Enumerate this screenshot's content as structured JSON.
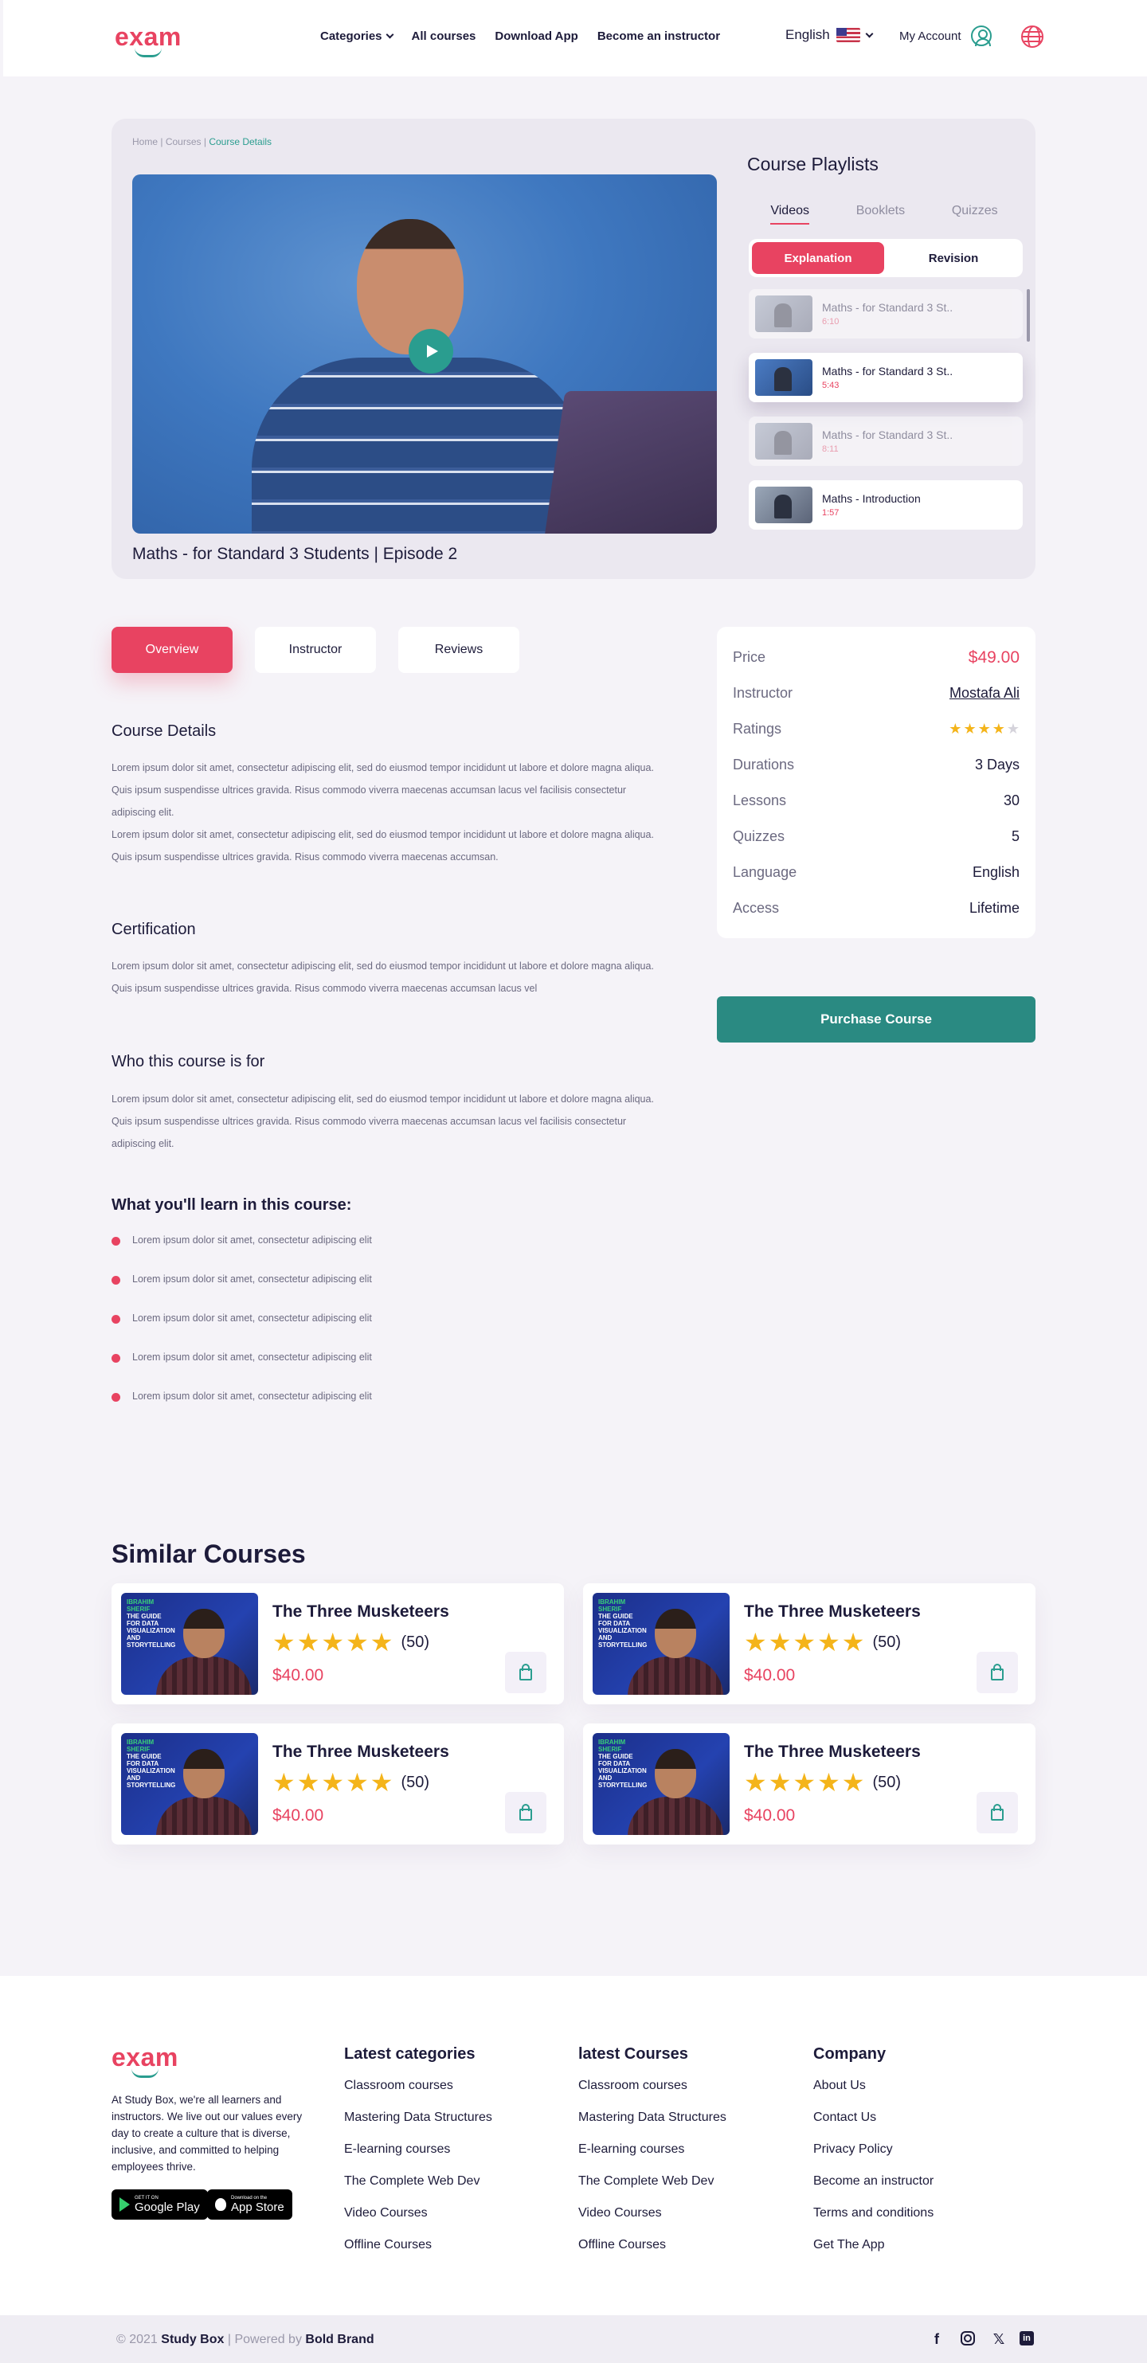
{
  "header": {
    "logo": "exam",
    "nav": [
      "Categories",
      "All courses",
      "Download App",
      "Become an instructor"
    ],
    "language": "English",
    "account": "My Account"
  },
  "breadcrumb": {
    "home": "Home",
    "courses": "Courses",
    "current": "Course Details",
    "separator": "|"
  },
  "video": {
    "title": "Maths - for Standard 3 Students | Episode 2"
  },
  "playlist": {
    "title": "Course Playlists",
    "tabs": [
      "Videos",
      "Booklets",
      "Quizzes"
    ],
    "segments": [
      "Explanation",
      "Revision"
    ],
    "items": [
      {
        "name": "Maths - for Standard 3 St..",
        "duration": "6:10"
      },
      {
        "name": "Maths - for Standard 3 St..",
        "duration": "5:43"
      },
      {
        "name": "Maths - for Standard 3 St..",
        "duration": "8:11"
      },
      {
        "name": "Maths - Introduction",
        "duration": "1:57"
      }
    ]
  },
  "tabs": [
    "Overview",
    "Instructor",
    "Reviews"
  ],
  "content": {
    "details_title": "Course Details",
    "details_p1": "Lorem ipsum dolor sit amet, consectetur adipiscing elit, sed do eiusmod tempor incididunt ut labore et dolore magna aliqua. Quis ipsum suspendisse ultrices gravida. Risus commodo viverra maecenas accumsan lacus vel facilisis consectetur adipiscing elit.",
    "details_p2": "Lorem ipsum dolor sit amet, consectetur adipiscing elit, sed do eiusmod tempor incididunt ut labore et dolore magna aliqua. Quis ipsum suspendisse ultrices gravida. Risus commodo viverra maecenas accumsan.",
    "cert_title": "Certification",
    "cert_p": "Lorem ipsum dolor sit amet, consectetur adipiscing elit, sed do eiusmod tempor incididunt ut labore et dolore magna aliqua. Quis ipsum suspendisse ultrices gravida. Risus commodo viverra maecenas accumsan lacus vel",
    "who_title": "Who this course is for",
    "who_p": "Lorem ipsum dolor sit amet, consectetur adipiscing elit, sed do eiusmod tempor incididunt ut labore et dolore magna aliqua. Quis ipsum suspendisse ultrices gravida. Risus commodo viverra maecenas accumsan lacus vel facilisis consectetur adipiscing elit.",
    "learn_title": "What you'll learn in this course:",
    "learn_items": [
      "Lorem ipsum dolor sit amet, consectetur adipiscing elit",
      "Lorem ipsum dolor sit amet, consectetur adipiscing elit",
      "Lorem ipsum dolor sit amet, consectetur adipiscing elit",
      "Lorem ipsum dolor sit amet, consectetur adipiscing elit",
      "Lorem ipsum dolor sit amet, consectetur adipiscing elit"
    ]
  },
  "info": {
    "price_label": "Price",
    "price": "$49.00",
    "instructor_label": "Instructor",
    "instructor": "Mostafa Ali",
    "ratings_label": "Ratings",
    "rating_value": 4,
    "rating_max": 5,
    "duration_label": "Durations",
    "duration": "3 Days",
    "lessons_label": "Lessons",
    "lessons": "30",
    "quizzes_label": "Quizzes",
    "quizzes": "5",
    "language_label": "Language",
    "language": "English",
    "access_label": "Access",
    "access": "Lifetime"
  },
  "purchase_label": "Purchase Course",
  "similar": {
    "title": "Similar Courses",
    "thumb_name": "IBRAHIM SHERIF",
    "thumb_caption": "THE GUIDE FOR DATA VISUALIZATION AND STORYTELLING",
    "courses": [
      {
        "name": "The Three Musketeers",
        "rating": 5,
        "count": "(50)",
        "price": "$40.00"
      },
      {
        "name": "The Three Musketeers",
        "rating": 5,
        "count": "(50)",
        "price": "$40.00"
      },
      {
        "name": "The Three Musketeers",
        "rating": 5,
        "count": "(50)",
        "price": "$40.00"
      },
      {
        "name": "The Three Musketeers",
        "rating": 5,
        "count": "(50)",
        "price": "$40.00"
      }
    ]
  },
  "footer": {
    "about": "At Study Box, we're all learners and instructors. We live out our values every day to create a culture that is diverse, inclusive, and committed to helping employees thrive.",
    "google_top": "GET IT ON",
    "google": "Google Play",
    "apple_top": "Download on the",
    "apple": "App Store",
    "columns": [
      {
        "title": "Latest categories",
        "links": [
          "Classroom courses",
          "Mastering Data Structures",
          "E-learning courses",
          "The Complete Web Dev",
          "Video Courses",
          "Offline Courses"
        ]
      },
      {
        "title": "latest Courses",
        "links": [
          "Classroom courses",
          "Mastering Data Structures",
          "E-learning courses",
          "The Complete Web Dev",
          "Video Courses",
          "Offline Courses"
        ]
      },
      {
        "title": "Company",
        "links": [
          "About Us",
          "Contact Us",
          "Privacy Policy",
          "Become an instructor",
          "Terms and conditions",
          "Get The App"
        ]
      }
    ],
    "copyright_year": "© 2021",
    "brand": "Study Box",
    "powered_by": "| Powered by",
    "agency": "Bold Brand"
  },
  "colors": {
    "accent": "#e84361",
    "teal": "#2a9d8f",
    "navy": "#1d1b3a",
    "star": "#f4b41a"
  },
  "icons": {
    "social": [
      "facebook-icon",
      "instagram-icon",
      "twitter-icon",
      "linkedin-icon"
    ]
  }
}
